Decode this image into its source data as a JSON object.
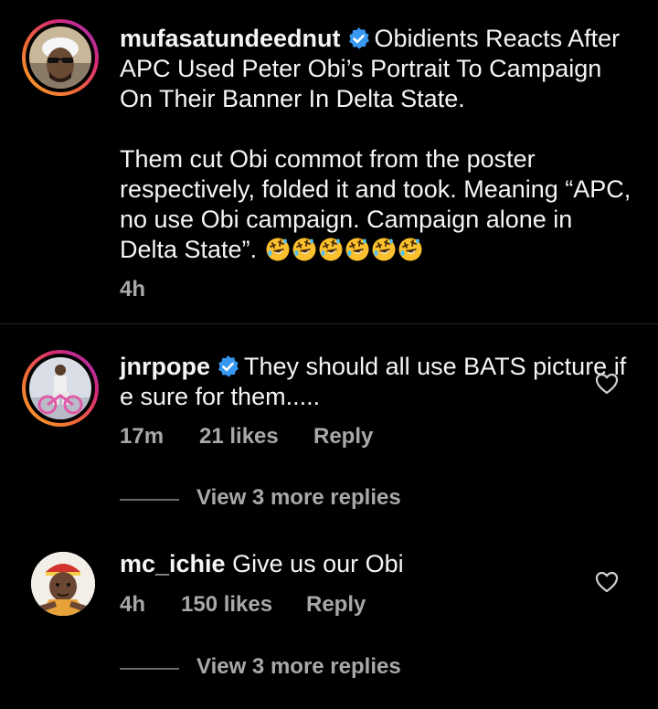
{
  "comments": [
    {
      "username": "mufasatundeednut",
      "verified": true,
      "paragraphs": [
        "Obidients Reacts After APC Used Peter Obi’s Portrait To Campaign On Their Banner In Delta State.",
        "Them cut Obi commot from the poster respectively, folded it and took. Meaning “APC, no use Obi campaign. Campaign alone in Delta State”."
      ],
      "emoji_count": 6,
      "time": "4h"
    },
    {
      "username": "jnrpope",
      "verified": true,
      "text": "They should all use BATS picture if e sure for them.....",
      "time": "17m",
      "likes": "21 likes",
      "reply_label": "Reply",
      "view_replies": "View 3 more replies"
    },
    {
      "username": "mc_ichie",
      "verified": false,
      "text": "Give us our Obi",
      "time": "4h",
      "likes": "150 likes",
      "reply_label": "Reply",
      "view_replies": "View 3 more replies"
    }
  ],
  "icons": {
    "verified": "verified-badge-icon",
    "like": "heart-outline-icon",
    "emoji": "rolling-on-floor-laughing-emoji"
  },
  "colors": {
    "background": "#000000",
    "text": "#f5f5f5",
    "meta": "#a8a8a8",
    "verified": "#3897f0",
    "divider": "#262626"
  }
}
